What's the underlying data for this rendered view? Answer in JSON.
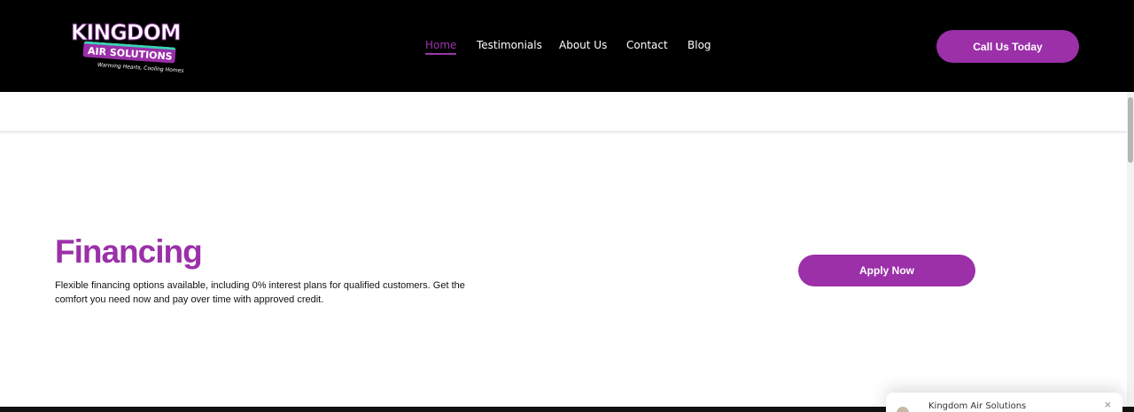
{
  "logo": {
    "line1": "KINGDOM",
    "line2": "AIR SOLUTIONS",
    "tagline": "Warming Hearts, Cooling Homes"
  },
  "nav": {
    "items": [
      {
        "label": "Home",
        "active": true
      },
      {
        "label": "Testimonials",
        "active": false
      },
      {
        "label": "About Us",
        "active": false
      },
      {
        "label": "Contact",
        "active": false
      },
      {
        "label": "Blog",
        "active": false
      }
    ]
  },
  "header": {
    "cta_label": "Call Us Today"
  },
  "financing": {
    "title": "Financing",
    "description": "Flexible financing options available, including 0% interest plans for qualified customers. Get the comfort you need now and pay over time with approved credit.",
    "apply_label": "Apply Now"
  },
  "chat": {
    "name": "Kingdom Air Solutions",
    "close_symbol": "×"
  },
  "colors": {
    "brand_purple": "#9b30a9",
    "header_bg": "#000000",
    "accent_teal": "#39d3b2"
  }
}
